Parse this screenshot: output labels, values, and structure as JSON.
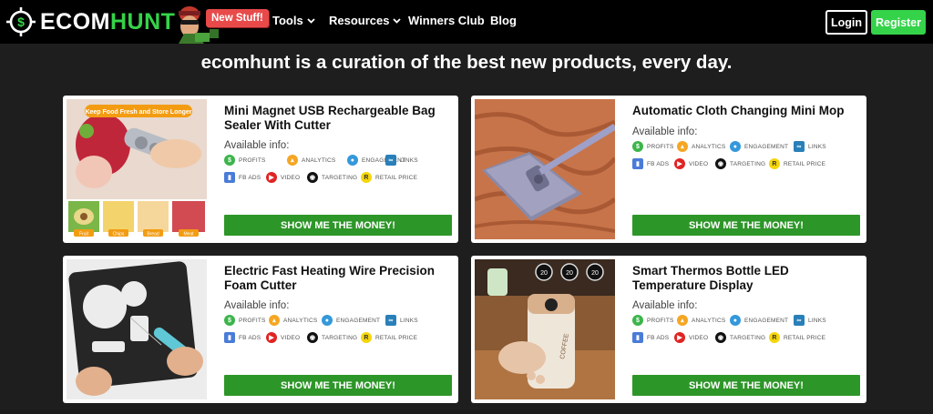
{
  "brand": {
    "logo_ecom": "ECOM",
    "logo_hunt": "HUNT",
    "badge": "New Stuff!"
  },
  "nav": {
    "tools": "Tools",
    "resources": "Resources",
    "winners_club": "Winners Club",
    "blog": "Blog",
    "login": "Login",
    "register": "Register"
  },
  "headline": "ecomhunt is a curation of the best new products, every day.",
  "available_info_label": "Available info:",
  "chips": {
    "profits": "PROFITS",
    "analytics": "ANALYTICS",
    "engagement": "ENGAGEMENT",
    "links": "LINKS",
    "fb_ads": "FB ADS",
    "video": "VIDEO",
    "targeting": "TARGETING",
    "retail_price": "RETAIL PRICE"
  },
  "money_button": "SHOW ME THE MONEY!",
  "products": [
    {
      "title": "Mini Magnet USB Rechargeable Bag Sealer With Cutter",
      "image_banner": "Keep Food Fresh and Store Longer",
      "image_tags": [
        "Fruit",
        "Chips",
        "Bread",
        "Meat"
      ]
    },
    {
      "title": "Automatic Cloth Changing Mini Mop"
    },
    {
      "title": "Electric Fast Heating Wire Precision Foam Cutter"
    },
    {
      "title": "Smart Thermos Bottle LED Temperature Display",
      "image_readouts": [
        "20",
        "20",
        "20"
      ],
      "image_label": "COFFEE"
    }
  ],
  "colors": {
    "accent_green": "#35d34a",
    "money_green": "#2d9628",
    "badge_red": "#e84a4a",
    "page_bg": "#1e1e1e"
  }
}
